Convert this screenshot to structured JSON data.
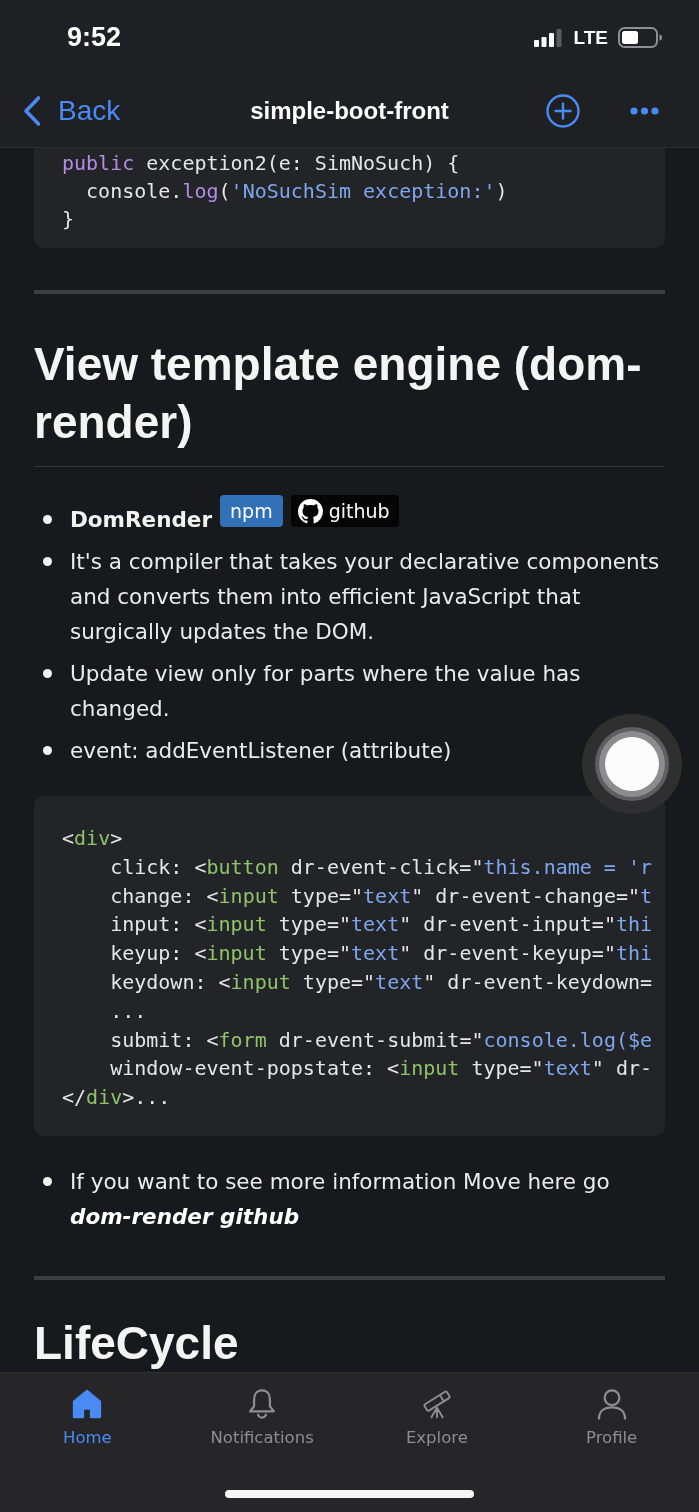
{
  "status_bar": {
    "time": "9:52",
    "network": "LTE"
  },
  "nav_bar": {
    "back": "Back",
    "title": "simple-boot-front"
  },
  "content": [
    {
      "kind": "code",
      "lines": [
        [
          {
            "kind": "keyword",
            "text": "public"
          },
          {
            "kind": "plain",
            "text": " exception2(e: SimNoSuch) {"
          }
        ],
        [
          {
            "kind": "plain",
            "text": "  console."
          },
          {
            "kind": "keyword",
            "text": "log"
          },
          {
            "kind": "plain",
            "text": "("
          },
          {
            "kind": "string",
            "text": "'NoSuchSim exception:'"
          },
          {
            "kind": "plain",
            "text": ")"
          }
        ],
        [
          {
            "kind": "plain",
            "text": "}"
          }
        ]
      ]
    },
    {
      "kind": "rule"
    },
    {
      "kind": "heading",
      "text": "View template engine (dom-render)"
    },
    {
      "kind": "list",
      "items": [
        {
          "kind": "title_badges",
          "title": "DomRender",
          "badges": [
            {
              "kind": "npm",
              "label": "npm"
            },
            {
              "kind": "github",
              "label": "github"
            }
          ]
        },
        {
          "kind": "text",
          "text": "It's a compiler that takes your declarative components and converts them into efficient JavaScript that surgically updates the DOM."
        },
        {
          "kind": "text",
          "text": "Update view only for parts where the value has changed."
        },
        {
          "kind": "text",
          "text": "event: addEventListener (attribute)"
        }
      ]
    },
    {
      "kind": "code",
      "lines": [
        [
          {
            "kind": "plain",
            "text": "<"
          },
          {
            "kind": "tag",
            "text": "div"
          },
          {
            "kind": "plain",
            "text": ">"
          }
        ],
        [
          {
            "kind": "plain",
            "text": "    click: <"
          },
          {
            "kind": "tag",
            "text": "button"
          },
          {
            "kind": "plain",
            "text": " dr-event-click=\""
          },
          {
            "kind": "string",
            "text": "this.name = 'r"
          }
        ],
        [
          {
            "kind": "plain",
            "text": "    change: <"
          },
          {
            "kind": "tag",
            "text": "input"
          },
          {
            "kind": "plain",
            "text": " type=\""
          },
          {
            "kind": "string",
            "text": "text"
          },
          {
            "kind": "plain",
            "text": "\" dr-event-change=\""
          },
          {
            "kind": "string",
            "text": "t"
          }
        ],
        [
          {
            "kind": "plain",
            "text": "    input: <"
          },
          {
            "kind": "tag",
            "text": "input"
          },
          {
            "kind": "plain",
            "text": " type=\""
          },
          {
            "kind": "string",
            "text": "text"
          },
          {
            "kind": "plain",
            "text": "\" dr-event-input=\""
          },
          {
            "kind": "string",
            "text": "thi"
          }
        ],
        [
          {
            "kind": "plain",
            "text": "    keyup: <"
          },
          {
            "kind": "tag",
            "text": "input"
          },
          {
            "kind": "plain",
            "text": " type=\""
          },
          {
            "kind": "string",
            "text": "text"
          },
          {
            "kind": "plain",
            "text": "\" dr-event-keyup=\""
          },
          {
            "kind": "string",
            "text": "thi"
          }
        ],
        [
          {
            "kind": "plain",
            "text": "    keydown: <"
          },
          {
            "kind": "tag",
            "text": "input"
          },
          {
            "kind": "plain",
            "text": " type=\""
          },
          {
            "kind": "string",
            "text": "text"
          },
          {
            "kind": "plain",
            "text": "\" dr-event-keydown="
          }
        ],
        [
          {
            "kind": "plain",
            "text": "    ..."
          }
        ],
        [
          {
            "kind": "plain",
            "text": "    submit: <"
          },
          {
            "kind": "tag",
            "text": "form"
          },
          {
            "kind": "plain",
            "text": " dr-event-submit=\""
          },
          {
            "kind": "string",
            "text": "console.log($e"
          }
        ],
        [
          {
            "kind": "plain",
            "text": "    window-event-popstate: <"
          },
          {
            "kind": "tag",
            "text": "input"
          },
          {
            "kind": "plain",
            "text": " type=\""
          },
          {
            "kind": "string",
            "text": "text"
          },
          {
            "kind": "plain",
            "text": "\" dr-"
          }
        ],
        [
          {
            "kind": "plain",
            "text": "</"
          },
          {
            "kind": "tag",
            "text": "div"
          },
          {
            "kind": "plain",
            "text": ">..."
          }
        ]
      ]
    },
    {
      "kind": "list",
      "items": [
        {
          "kind": "link_text",
          "text": "If you want to see more information Move here go",
          "link": "dom-render github"
        }
      ]
    },
    {
      "kind": "rule"
    },
    {
      "kind": "heading",
      "text": "LifeCycle"
    }
  ],
  "tab_bar": [
    {
      "label": "Home",
      "selected": true
    },
    {
      "label": "Notifications",
      "selected": false
    },
    {
      "label": "Explore",
      "selected": false
    },
    {
      "label": "Profile",
      "selected": false
    }
  ]
}
